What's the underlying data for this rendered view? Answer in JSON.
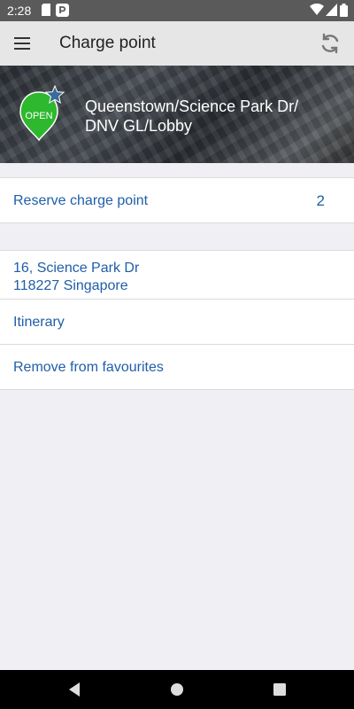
{
  "status_bar": {
    "time": "2:28",
    "icons": [
      "sd-card-icon",
      "app-notification-icon",
      "wifi-icon",
      "signal-icon",
      "battery-icon"
    ]
  },
  "app_bar": {
    "title": "Charge point",
    "menu_icon": "hamburger-menu-icon",
    "refresh_icon": "refresh-icon"
  },
  "station": {
    "status_badge": "OPEN",
    "name_line1": "Queenstown/Science Park Dr/",
    "name_line2": "DNV GL/Lobby",
    "favourite": true,
    "colors": {
      "open_green": "#2db82d",
      "star_blue": "#3a6b9a"
    }
  },
  "reservation": {
    "label": "Reserve charge point",
    "count": "2"
  },
  "details": {
    "address_line1": "16, Science Park Dr",
    "address_line2": "118227 Singapore",
    "itinerary_label": "Itinerary",
    "remove_favourite_label": "Remove from favourites"
  },
  "nav_bar": {
    "buttons": [
      "back-icon",
      "home-icon",
      "recents-icon"
    ]
  },
  "colors": {
    "link_blue": "#1f5ea8",
    "app_bar_bg": "#e6e6e6",
    "page_bg": "#efeff4"
  }
}
